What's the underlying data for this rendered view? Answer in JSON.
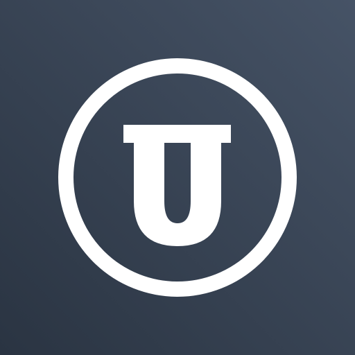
{
  "icon": {
    "name": "u-circle-logo",
    "glyph": "U",
    "colors": {
      "background_top_right": "#465366",
      "background_bottom_left": "#2a3442",
      "foreground": "#ffffff"
    }
  }
}
